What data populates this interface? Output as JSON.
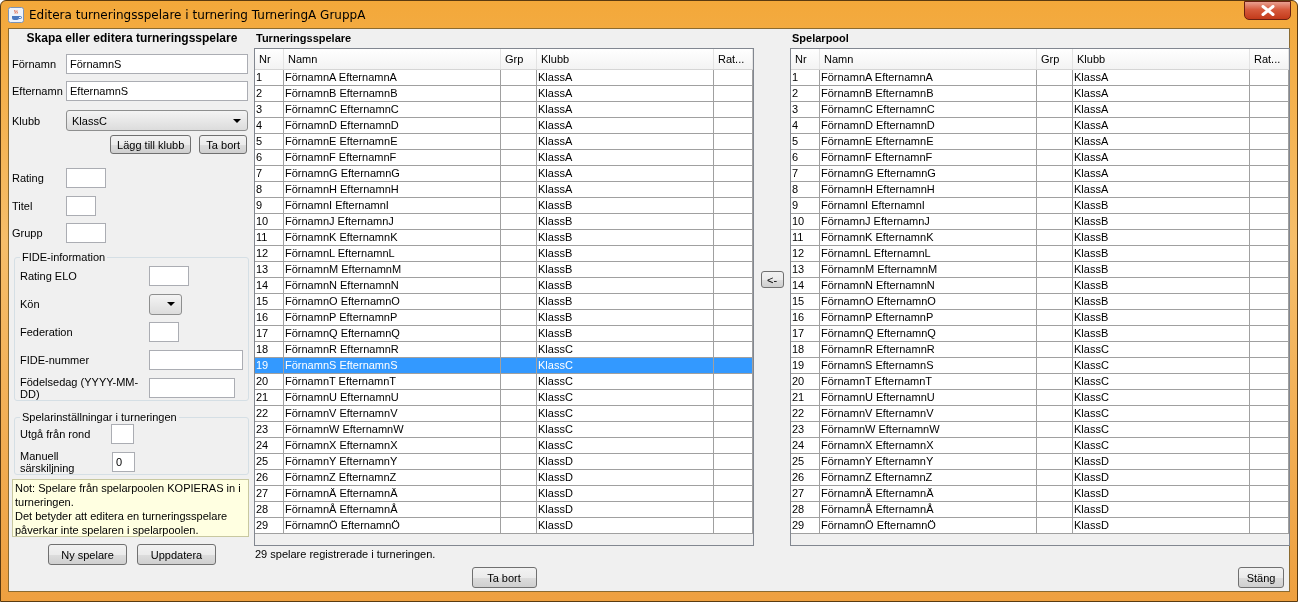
{
  "window": {
    "title": "Editera turneringsspelare i turnering TurneringA GruppA"
  },
  "editor": {
    "title": "Skapa eller editera turneringsspelare",
    "name_fields": [
      {
        "label": "Förnamn",
        "value": "FörnamnS"
      },
      {
        "label": "Efternamn",
        "value": "EfternamnS"
      }
    ],
    "club": {
      "label": "Klubb",
      "value": "KlassC"
    },
    "club_buttons": [
      "Lägg till klubb",
      "Ta bort"
    ],
    "short_fields": [
      {
        "label": "Rating"
      },
      {
        "label": "Titel"
      },
      {
        "label": "Grupp"
      }
    ],
    "fide": {
      "title": "FIDE-information",
      "fields": [
        {
          "label": "Rating ELO",
          "kind": "text"
        },
        {
          "label": "Kön",
          "kind": "combo"
        },
        {
          "label": "Federation",
          "kind": "text"
        },
        {
          "label": "FIDE-nummer",
          "kind": "text"
        },
        {
          "label": "Födelsedag (YYYY-MM-DD)",
          "kind": "text"
        }
      ]
    },
    "settings": {
      "title": "Spelarinställningar i turneringen",
      "fields": [
        {
          "label": "Utgå från rond"
        },
        {
          "label": "Manuell särskiljning",
          "value": "0"
        }
      ]
    },
    "note": [
      "Not: Spelare från spelarpoolen KOPIERAS in i turneringen.",
      "Det betyder att editera en turneringsspelare påverkar inte spelaren i spelarpoolen."
    ],
    "buttons": [
      "Ny spelare",
      "Uppdatera"
    ]
  },
  "tournament": {
    "title": "Turneringsspelare",
    "columns": [
      "Nr",
      "Namn",
      "Grp",
      "Klubb",
      "Rat..."
    ],
    "rows": [
      {
        "nr": "1",
        "name": "FörnamnA EfternamnA",
        "club": "KlassA",
        "selected": false
      },
      {
        "nr": "2",
        "name": "FörnamnB EfternamnB",
        "club": "KlassA",
        "selected": false
      },
      {
        "nr": "3",
        "name": "FörnamnC EfternamnC",
        "club": "KlassA",
        "selected": false
      },
      {
        "nr": "4",
        "name": "FörnamnD EfternamnD",
        "club": "KlassA",
        "selected": false
      },
      {
        "nr": "5",
        "name": "FörnamnE EfternamnE",
        "club": "KlassA",
        "selected": false
      },
      {
        "nr": "6",
        "name": "FörnamnF EfternamnF",
        "club": "KlassA",
        "selected": false
      },
      {
        "nr": "7",
        "name": "FörnamnG EfternamnG",
        "club": "KlassA",
        "selected": false
      },
      {
        "nr": "8",
        "name": "FörnamnH EfternamnH",
        "club": "KlassA",
        "selected": false
      },
      {
        "nr": "9",
        "name": "FörnamnI EfternamnI",
        "club": "KlassB",
        "selected": false
      },
      {
        "nr": "10",
        "name": "FörnamnJ EfternamnJ",
        "club": "KlassB",
        "selected": false
      },
      {
        "nr": "11",
        "name": "FörnamnK EfternamnK",
        "club": "KlassB",
        "selected": false
      },
      {
        "nr": "12",
        "name": "FörnamnL EfternamnL",
        "club": "KlassB",
        "selected": false
      },
      {
        "nr": "13",
        "name": "FörnamnM EfternamnM",
        "club": "KlassB",
        "selected": false
      },
      {
        "nr": "14",
        "name": "FörnamnN EfternamnN",
        "club": "KlassB",
        "selected": false
      },
      {
        "nr": "15",
        "name": "FörnamnO EfternamnO",
        "club": "KlassB",
        "selected": false
      },
      {
        "nr": "16",
        "name": "FörnamnP EfternamnP",
        "club": "KlassB",
        "selected": false
      },
      {
        "nr": "17",
        "name": "FörnamnQ EfternamnQ",
        "club": "KlassB",
        "selected": false
      },
      {
        "nr": "18",
        "name": "FörnamnR EfternamnR",
        "club": "KlassC",
        "selected": false
      },
      {
        "nr": "19",
        "name": "FörnamnS EfternamnS",
        "club": "KlassC",
        "selected": true
      },
      {
        "nr": "20",
        "name": "FörnamnT EfternamnT",
        "club": "KlassC",
        "selected": false
      },
      {
        "nr": "21",
        "name": "FörnamnU EfternamnU",
        "club": "KlassC",
        "selected": false
      },
      {
        "nr": "22",
        "name": "FörnamnV EfternamnV",
        "club": "KlassC",
        "selected": false
      },
      {
        "nr": "23",
        "name": "FörnamnW EfternamnW",
        "club": "KlassC",
        "selected": false
      },
      {
        "nr": "24",
        "name": "FörnamnX EfternamnX",
        "club": "KlassC",
        "selected": false
      },
      {
        "nr": "25",
        "name": "FörnamnY EfternamnY",
        "club": "KlassD",
        "selected": false
      },
      {
        "nr": "26",
        "name": "FörnamnZ EfternamnZ",
        "club": "KlassD",
        "selected": false
      },
      {
        "nr": "27",
        "name": "FörnamnÄ EfternamnÄ",
        "club": "KlassD",
        "selected": false
      },
      {
        "nr": "28",
        "name": "FörnamnÅ EfternamnÅ",
        "club": "KlassD",
        "selected": false
      },
      {
        "nr": "29",
        "name": "FörnamnÖ EfternamnÖ",
        "club": "KlassD",
        "selected": false
      }
    ],
    "status": "29 spelare registrerade i turneringen.",
    "button": "Ta bort"
  },
  "transfer_button": "<-",
  "pool": {
    "title": "Spelarpool",
    "columns": [
      "Nr",
      "Namn",
      "Grp",
      "Klubb",
      "Rat..."
    ],
    "rows": [
      {
        "nr": "1",
        "name": "FörnamnA EfternamnA",
        "club": "KlassA",
        "selected": false
      },
      {
        "nr": "2",
        "name": "FörnamnB EfternamnB",
        "club": "KlassA",
        "selected": false
      },
      {
        "nr": "3",
        "name": "FörnamnC EfternamnC",
        "club": "KlassA",
        "selected": false
      },
      {
        "nr": "4",
        "name": "FörnamnD EfternamnD",
        "club": "KlassA",
        "selected": false
      },
      {
        "nr": "5",
        "name": "FörnamnE EfternamnE",
        "club": "KlassA",
        "selected": false
      },
      {
        "nr": "6",
        "name": "FörnamnF EfternamnF",
        "club": "KlassA",
        "selected": false
      },
      {
        "nr": "7",
        "name": "FörnamnG EfternamnG",
        "club": "KlassA",
        "selected": false
      },
      {
        "nr": "8",
        "name": "FörnamnH EfternamnH",
        "club": "KlassA",
        "selected": false
      },
      {
        "nr": "9",
        "name": "FörnamnI EfternamnI",
        "club": "KlassB",
        "selected": false
      },
      {
        "nr": "10",
        "name": "FörnamnJ EfternamnJ",
        "club": "KlassB",
        "selected": false
      },
      {
        "nr": "11",
        "name": "FörnamnK EfternamnK",
        "club": "KlassB",
        "selected": false
      },
      {
        "nr": "12",
        "name": "FörnamnL EfternamnL",
        "club": "KlassB",
        "selected": false
      },
      {
        "nr": "13",
        "name": "FörnamnM EfternamnM",
        "club": "KlassB",
        "selected": false
      },
      {
        "nr": "14",
        "name": "FörnamnN EfternamnN",
        "club": "KlassB",
        "selected": false
      },
      {
        "nr": "15",
        "name": "FörnamnO EfternamnO",
        "club": "KlassB",
        "selected": false
      },
      {
        "nr": "16",
        "name": "FörnamnP EfternamnP",
        "club": "KlassB",
        "selected": false
      },
      {
        "nr": "17",
        "name": "FörnamnQ EfternamnQ",
        "club": "KlassB",
        "selected": false
      },
      {
        "nr": "18",
        "name": "FörnamnR EfternamnR",
        "club": "KlassC",
        "selected": false
      },
      {
        "nr": "19",
        "name": "FörnamnS EfternamnS",
        "club": "KlassC",
        "selected": false
      },
      {
        "nr": "20",
        "name": "FörnamnT EfternamnT",
        "club": "KlassC",
        "selected": false
      },
      {
        "nr": "21",
        "name": "FörnamnU EfternamnU",
        "club": "KlassC",
        "selected": false
      },
      {
        "nr": "22",
        "name": "FörnamnV EfternamnV",
        "club": "KlassC",
        "selected": false
      },
      {
        "nr": "23",
        "name": "FörnamnW EfternamnW",
        "club": "KlassC",
        "selected": false
      },
      {
        "nr": "24",
        "name": "FörnamnX EfternamnX",
        "club": "KlassC",
        "selected": false
      },
      {
        "nr": "25",
        "name": "FörnamnY EfternamnY",
        "club": "KlassD",
        "selected": false
      },
      {
        "nr": "26",
        "name": "FörnamnZ EfternamnZ",
        "club": "KlassD",
        "selected": false
      },
      {
        "nr": "27",
        "name": "FörnamnÄ EfternamnÄ",
        "club": "KlassD",
        "selected": false
      },
      {
        "nr": "28",
        "name": "FörnamnÅ EfternamnÅ",
        "club": "KlassD",
        "selected": false
      },
      {
        "nr": "29",
        "name": "FörnamnÖ EfternamnÖ",
        "club": "KlassD",
        "selected": false
      }
    ],
    "button": "Stäng"
  }
}
